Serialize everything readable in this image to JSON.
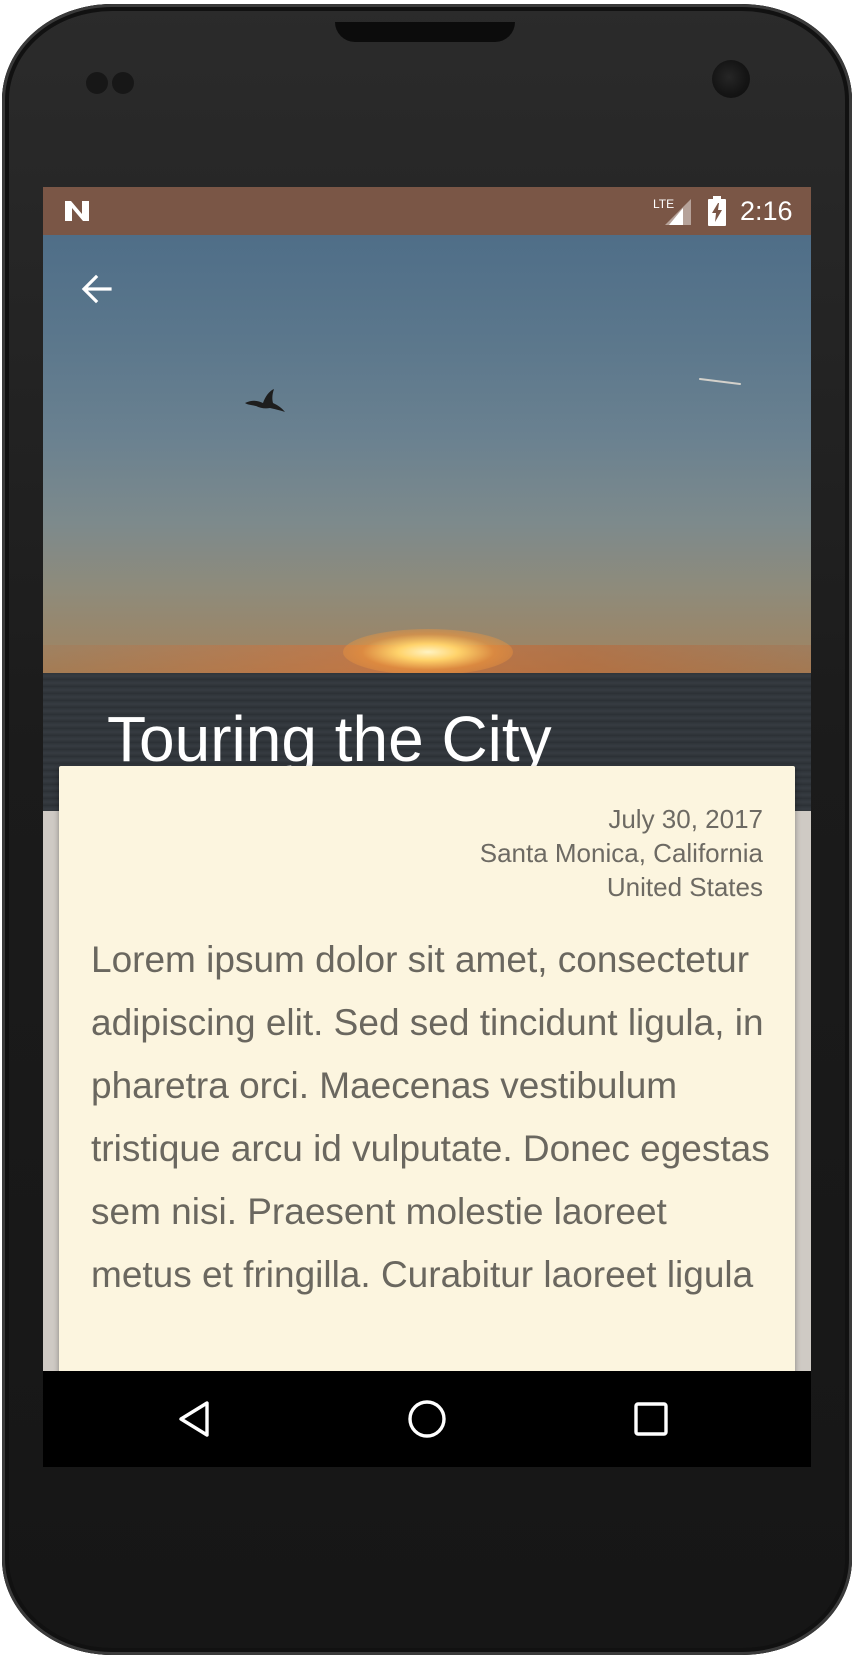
{
  "status_bar": {
    "time": "2:16",
    "network_label": "LTE",
    "notification_icon": "n-icon",
    "battery_icon": "battery-charging-icon",
    "background_color": "#7a5646"
  },
  "hero": {
    "title": "Touring the City",
    "back_icon": "arrow-back-icon"
  },
  "entry": {
    "date": "July 30, 2017",
    "location_line1": "Santa Monica, California",
    "location_line2": "United States",
    "body": "Lorem ipsum dolor sit amet, consectetur adipiscing elit. Sed sed tincidunt ligula, in pharetra orci. Maecenas vestibulum tristique arcu id vulputate. Donec egestas sem nisi. Praesent molestie laoreet metus et fringilla. Curabitur laoreet ligula",
    "card_color": "#fcf5df"
  },
  "nav_bar": {
    "back_icon": "triangle-back-icon",
    "home_icon": "circle-home-icon",
    "recents_icon": "square-recents-icon"
  }
}
